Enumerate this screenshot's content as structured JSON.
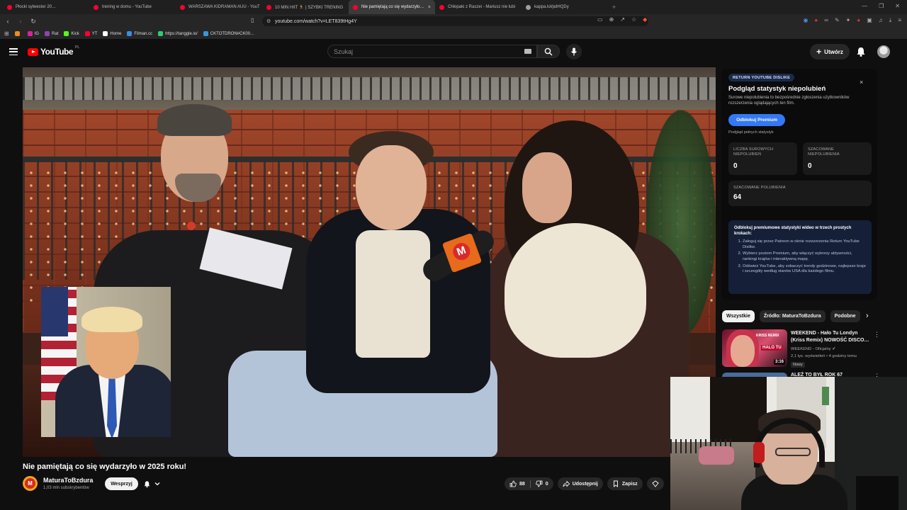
{
  "browser": {
    "tabs": [
      {
        "label": "Płocki sylwester 20…",
        "fav_color": "#ff0033",
        "active": false
      },
      {
        "label": "trening w domu - YouTube",
        "fav_color": "#ff0033",
        "active": false
      },
      {
        "label": "WARSZAWA KIDRAMAN AUU - YouT",
        "fav_color": "#ff0033",
        "active": false
      },
      {
        "label": "10 MIN HIIT 🏃 | SZYBKI TRENING",
        "fav_color": "#ff0033",
        "active": false
      },
      {
        "label": "Nie pamiętają co się wydarzyło…",
        "fav_color": "#ff0033",
        "active": true
      },
      {
        "label": "Chłopaki z Raszei - Mariusz nie lubi",
        "fav_color": "#ff0033",
        "active": false
      },
      {
        "label": "kappa.lol/pdHQDy",
        "fav_color": "#9aa0a6",
        "active": false
      }
    ],
    "url": "youtube.com/watch?v=LET839tHg4Y",
    "bookmarks": [
      {
        "label": "",
        "color": "#f08a24"
      },
      {
        "label": "IG",
        "color": "#d6249f"
      },
      {
        "label": "Rat",
        "color": "#8e44ad"
      },
      {
        "label": "Kick",
        "color": "#53fc18"
      },
      {
        "label": "YT",
        "color": "#ff0033"
      },
      {
        "label": "Home",
        "color": "#ffffff"
      },
      {
        "label": "Filman.cc",
        "color": "#3a8ee6"
      },
      {
        "label": "https://tanggle.io/",
        "color": "#2ecc71"
      },
      {
        "label": "CKTOTDRON#CK00…",
        "color": "#3498db"
      }
    ]
  },
  "header": {
    "logo_text": "YouTube",
    "logo_country": "PL",
    "search_placeholder": "Szukaj",
    "create_label": "Utwórz"
  },
  "video": {
    "title": "Nie pamiętają co się wydarzyło w 2025 roku!",
    "channel_name": "MaturaToBzdura",
    "channel_initial": "M",
    "subscribers": "1,03 mln subskrybentów",
    "support_label": "Wesprzyj",
    "likes": "88",
    "dislikes": "0",
    "share_label": "Udostępnij",
    "save_label": "Zapisz"
  },
  "ryd": {
    "tag": "RETURN YOUTUBE DISLIKE",
    "close": "×",
    "title": "Podgląd statystyk niepolubień",
    "description": "Surowe niepolubienia to bezpośrednie zgłoszenia użytkowników rozszerzenia oglądających ten film.",
    "unlock_btn": "Odblokuj Premium",
    "full_stats": "Podgląd pełnych statystyk",
    "stats": [
      {
        "label": "LICZBA SUROWYCH NIEPOLUBIEŃ",
        "value": "0"
      },
      {
        "label": "SZACOWANE NIEPOLUBIENIA",
        "value": "0"
      },
      {
        "label": "SZACOWANE POLUBIENIA",
        "value": "64"
      }
    ],
    "info_heading": "Odblokuj premiumowe statystyki wideo w trzech prostych krokach:",
    "steps": [
      "Zaloguj się przez Patreon w oknie rozszerzenia Return YouTube Dislike.",
      "Wybierz poziom Premium, aby włączyć wykresy aktywności, rankingi krajów i interaktywną mapę.",
      "Odśwież YouTube, aby zobaczyć trendy godzinowe, najlepsze kraje i szczegóły według stanów USA dla każdego filmu."
    ]
  },
  "chips": [
    "Wszystkie",
    "Źródło: MaturaToBzdura",
    "Podobne"
  ],
  "recommendations": [
    {
      "title": "WEEKEND - Hało Tu Londyn (Kriss Remix) NOWOŚĆ DISCO…",
      "channel": "WEEKEND - Oficjalny",
      "meta": "2,1 tys. wyświetleń • 4 godziny temu",
      "badge": "Nowy",
      "duration": "3:16",
      "thumb_text": "HALO TU",
      "thumb_label": "KRISS REMIX"
    },
    {
      "title": "ALEŻ TO BYŁ ROK 67"
    }
  ]
}
